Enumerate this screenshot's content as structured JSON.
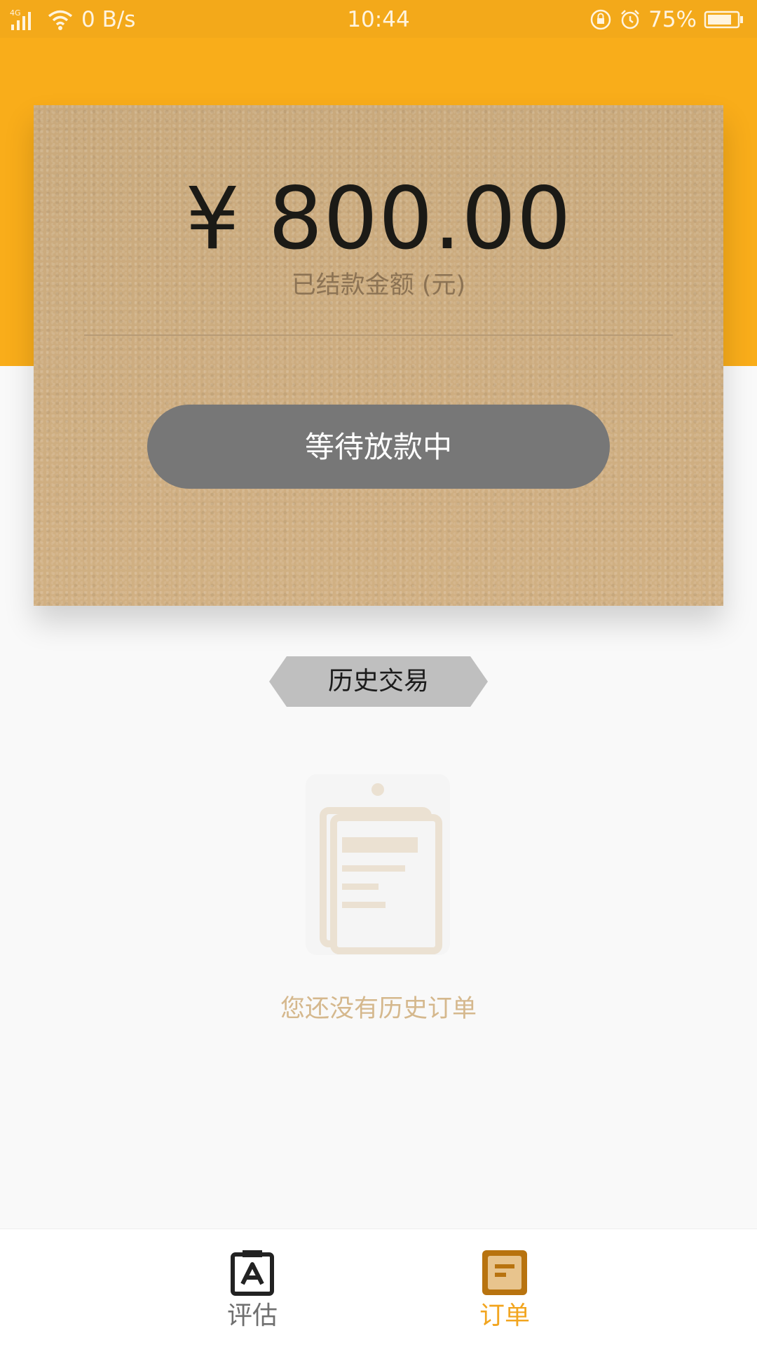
{
  "status_bar": {
    "network": "4G",
    "speed": "0 B/s",
    "time": "10:44",
    "battery": "75%"
  },
  "card": {
    "amount": "¥ 800.00",
    "amount_label": "已结款金额 (元)",
    "status_button": "等待放款中"
  },
  "history": {
    "tag": "历史交易",
    "empty_text": "您还没有历史订单"
  },
  "bottom_nav": {
    "items": [
      {
        "label": "评估",
        "icon": "clipboard-a-icon",
        "active": false
      },
      {
        "label": "订单",
        "icon": "order-icon",
        "active": true
      }
    ]
  },
  "colors": {
    "header": "#f9ad1a",
    "status_bar": "#f3a91a",
    "card": "#cfae7e",
    "button": "#777777",
    "active_tab": "#f2a51f",
    "empty_text": "#d5b88d"
  }
}
